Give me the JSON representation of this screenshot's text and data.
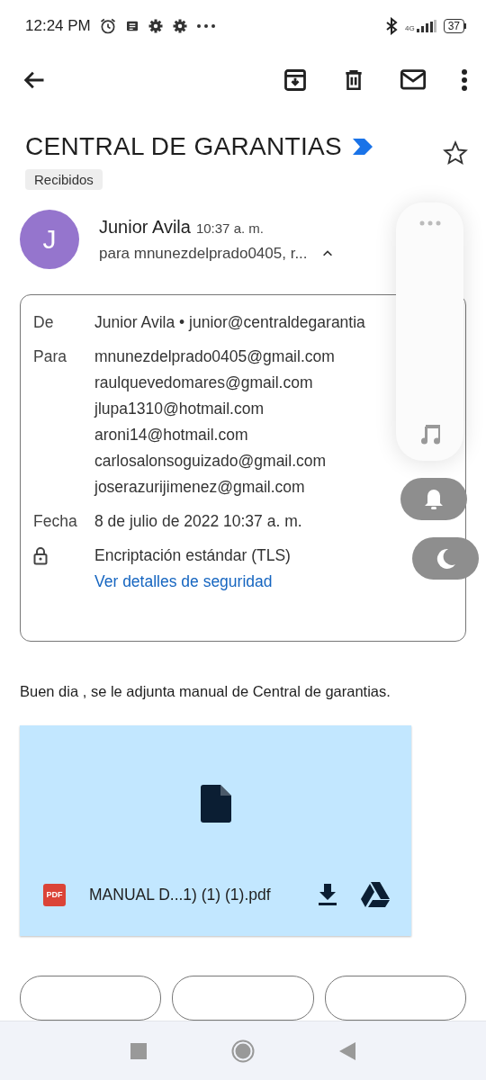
{
  "status_bar": {
    "time": "12:24 PM",
    "network": "4G",
    "battery": "37"
  },
  "email": {
    "subject": "CENTRAL DE GARANTIAS",
    "label": "Recibidos",
    "starred": false,
    "sender": {
      "initial": "J",
      "name": "Junior Avila",
      "time": "10:37 a. m.",
      "recipients": "para mnunezdelprado0405, r...",
      "expanded": true
    },
    "details": [
      {
        "label": "De",
        "kind": "text",
        "values": [
          "Junior Avila • junior@centraldegarantia"
        ]
      },
      {
        "label": "Para",
        "kind": "text",
        "values": [
          "mnunezdelprado0405@gmail.com",
          "raulquevedomares@gmail.com",
          "jlupa1310@hotmail.com",
          "aroni14@hotmail.com",
          "carlosalonsoguizado@gmail.com",
          "joserazurijimenez@gmail.com"
        ]
      },
      {
        "label": "Fecha",
        "kind": "text",
        "values": [
          "8 de julio de 2022 10:37 a. m."
        ]
      },
      {
        "kind": "security",
        "values": [
          "Encriptación estándar (TLS)"
        ],
        "link": "Ver detalles de seguridad"
      }
    ],
    "body": "Buen dia , se le adjunta manual de Central de garantias.",
    "attachment": {
      "type": "PDF",
      "filename": "MANUAL D...1) (1) (1).pdf"
    },
    "reply_buttons": [
      {
        "kind": "outlined"
      },
      {
        "kind": "outlined"
      },
      {
        "kind": "outlined"
      }
    ]
  },
  "quick_panel": {
    "toggles": [
      {
        "kind": "bell",
        "on": false
      },
      {
        "kind": "moon",
        "on": false
      }
    ]
  }
}
